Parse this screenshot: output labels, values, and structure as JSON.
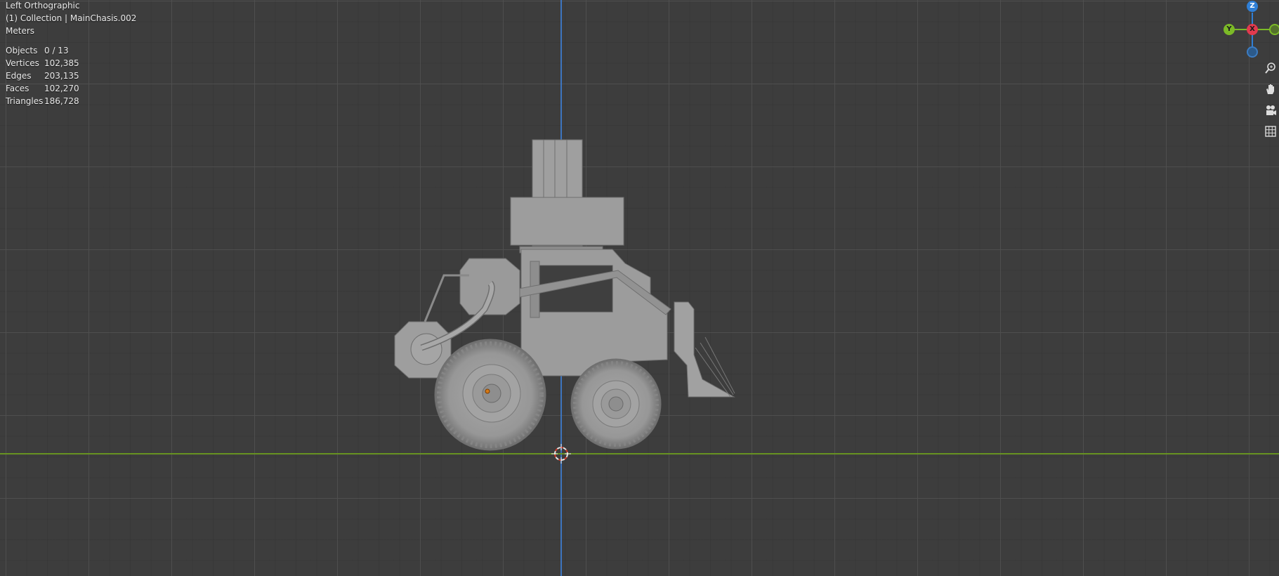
{
  "viewport": {
    "view_name": "Left Orthographic",
    "collection_info": "(1) Collection | MainChasis.002",
    "units": "Meters"
  },
  "stats": [
    {
      "label": "Objects",
      "value": "0 / 13"
    },
    {
      "label": "Vertices",
      "value": "102,385"
    },
    {
      "label": "Edges",
      "value": "203,135"
    },
    {
      "label": "Faces",
      "value": "102,270"
    },
    {
      "label": "Triangles",
      "value": "186,728"
    }
  ],
  "gizmo": {
    "z_label": "Z",
    "y_label": "Y",
    "x_label": "X",
    "colors": {
      "z": "#2f7fd6",
      "y": "#7cba27",
      "x": "#e23a4e"
    }
  },
  "nav_buttons": [
    {
      "icon": "zoom-icon"
    },
    {
      "icon": "pan-hand-icon"
    },
    {
      "icon": "camera-icon"
    },
    {
      "icon": "grid-icon"
    }
  ],
  "colors": {
    "background": "#3d3d3d",
    "model": "#9a9a9a",
    "z_axis": "#3d7fd6",
    "y_axis": "#6c9b1e"
  }
}
